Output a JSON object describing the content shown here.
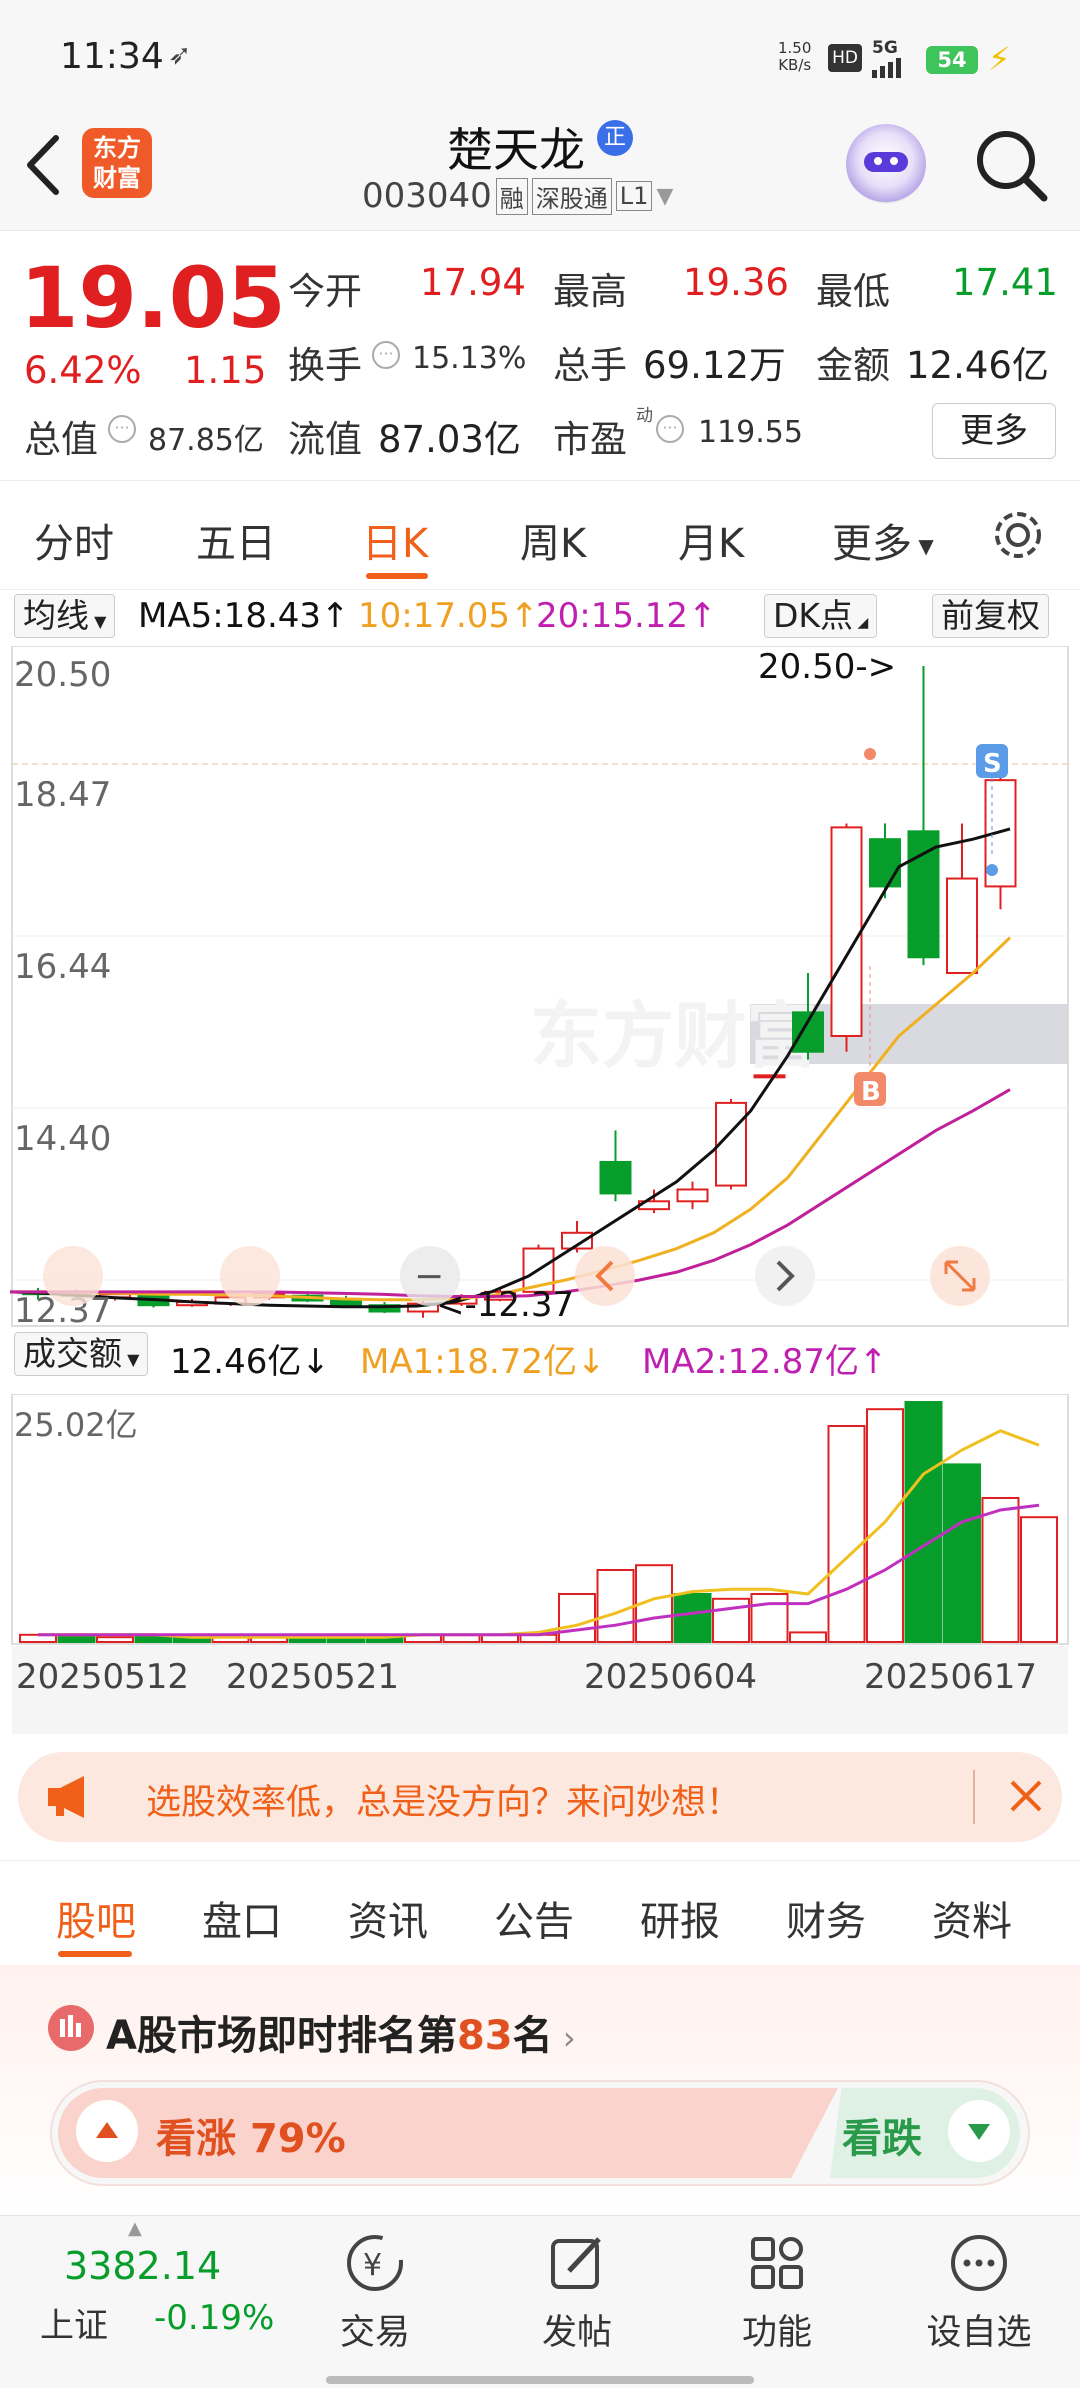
{
  "status": {
    "time": "11:34",
    "net_speed": "1.50",
    "net_unit": "KB/s",
    "hd": "HD",
    "signal": "5G",
    "battery": "54"
  },
  "header": {
    "brand_line1": "东方",
    "brand_line2": "财富",
    "stock_name": "楚天龙",
    "badge": "正",
    "code": "003040",
    "tag_rong": "融",
    "tag_connect": "深股通",
    "tag_level": "L1"
  },
  "quote": {
    "price": "19.05",
    "change_pct": "6.42%",
    "change": "1.15",
    "open_label": "今开",
    "open": "17.94",
    "high_label": "最高",
    "high": "19.36",
    "low_label": "最低",
    "low": "17.41",
    "turnover_label": "换手",
    "turnover": "15.13%",
    "volume_label": "总手",
    "volume": "69.12万",
    "amount_label": "金额",
    "amount": "12.46亿",
    "mktcap_label": "总值",
    "mktcap": "87.85亿",
    "float_label": "流值",
    "float_cap": "87.03亿",
    "pe_label": "市盈",
    "pe_sup": "动",
    "pe": "119.55",
    "more": "更多"
  },
  "tabs": [
    "分时",
    "五日",
    "日K",
    "周K",
    "月K",
    "更多"
  ],
  "active_tab": "日K",
  "kline": {
    "ma_button": "均线",
    "ma5": "MA5:18.43",
    "ma10": "10:17.05",
    "ma20": "20:15.12",
    "dk_button": "DK点",
    "fq_button": "前复权",
    "y_labels": [
      "20.50",
      "18.47",
      "16.44",
      "14.40",
      "12.37"
    ],
    "high_marker": "20.50->",
    "low_marker": "<-12.37",
    "watermark": "东方财富",
    "sell_mark": "S",
    "buy_mark": "B"
  },
  "volume": {
    "button": "成交额",
    "value": "12.46亿",
    "ma1": "MA1:18.72亿",
    "ma2": "MA2:12.87亿",
    "y_top": "25.02亿",
    "dates": [
      "20250512",
      "20250521",
      "20250604",
      "20250617"
    ]
  },
  "colors": {
    "up": "#e02020",
    "down": "#079d2a",
    "ma5": "#111111",
    "ma10": "#f0b020",
    "ma20": "#c0209a"
  },
  "chart_data": {
    "type": "candlestick",
    "series": [
      {
        "name": "MA5",
        "values": [
          12.55,
          12.53,
          12.5,
          12.47,
          12.45,
          12.42,
          12.4,
          12.38,
          12.37,
          12.36,
          12.36,
          12.37,
          12.42,
          12.55,
          12.75,
          13.05,
          13.35,
          13.65,
          13.95,
          14.35,
          14.85,
          15.55,
          16.35,
          17.15,
          17.95,
          18.2,
          18.3,
          18.43
        ]
      },
      {
        "name": "MA10",
        "values": [
          12.55,
          12.55,
          12.54,
          12.53,
          12.52,
          12.52,
          12.51,
          12.5,
          12.48,
          12.46,
          12.45,
          12.45,
          12.46,
          12.5,
          12.6,
          12.7,
          12.82,
          12.95,
          13.1,
          13.3,
          13.6,
          14.0,
          14.6,
          15.2,
          15.8,
          16.2,
          16.6,
          17.05
        ]
      },
      {
        "name": "MA20",
        "values": [
          12.55,
          12.55,
          12.55,
          12.55,
          12.55,
          12.55,
          12.55,
          12.55,
          12.54,
          12.53,
          12.52,
          12.5,
          12.49,
          12.49,
          12.5,
          12.55,
          12.62,
          12.7,
          12.8,
          12.95,
          13.15,
          13.4,
          13.7,
          14.0,
          14.3,
          14.6,
          14.85,
          15.12
        ]
      }
    ],
    "ylim": [
      12.37,
      20.5
    ]
  }
}
